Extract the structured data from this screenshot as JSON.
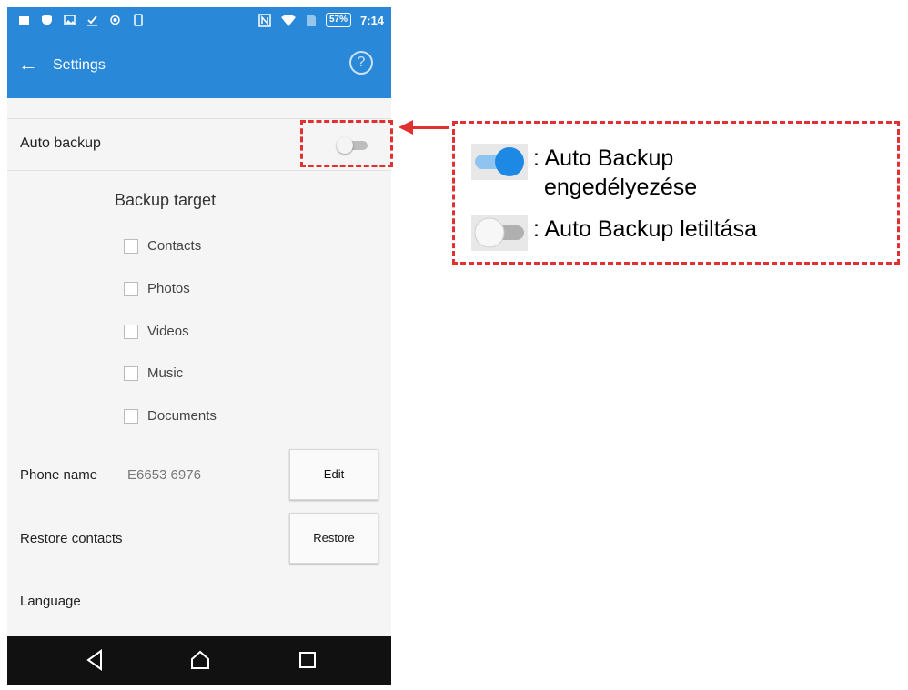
{
  "status_bar": {
    "battery": "57%",
    "time": "7:14"
  },
  "app_bar": {
    "title": "Settings"
  },
  "auto_backup": {
    "label": "Auto backup",
    "enabled": false
  },
  "backup_target": {
    "title": "Backup target",
    "options": [
      {
        "label": "Contacts",
        "checked": false
      },
      {
        "label": "Photos",
        "checked": false
      },
      {
        "label": "Videos",
        "checked": false
      },
      {
        "label": "Music",
        "checked": false
      },
      {
        "label": "Documents",
        "checked": false
      }
    ]
  },
  "phone_name": {
    "label": "Phone name",
    "value": "E6653 6976",
    "button": "Edit"
  },
  "restore_contacts": {
    "label": "Restore contacts",
    "button": "Restore"
  },
  "language": {
    "label": "Language"
  },
  "legend": {
    "on_text_line1": ": Auto Backup",
    "on_text_line2": "engedélyezése",
    "off_text": ": Auto Backup letiltása"
  },
  "colors": {
    "accent": "#2a88d8",
    "toggle_on": "#1e88e5",
    "callout": "#e03030",
    "nav": "#111111"
  }
}
